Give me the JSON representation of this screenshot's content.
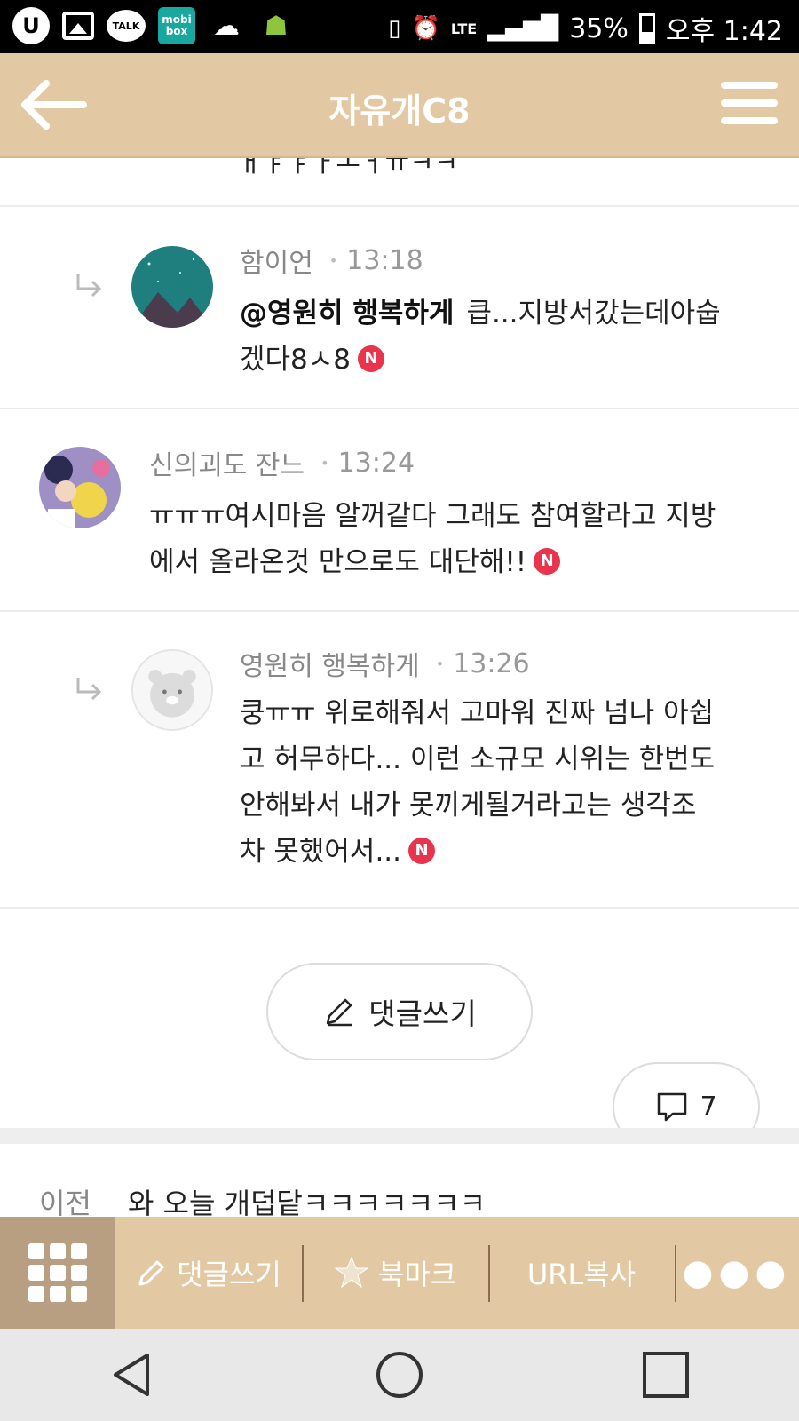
{
  "status_bar": {
    "left_icons": [
      "u-plus-icon",
      "gallery-icon",
      "kakaotalk-icon",
      "mobibox-icon",
      "bird-icon",
      "android-icon"
    ],
    "talk_label": "TALK",
    "mobi_label_top": "mobi",
    "mobi_label_bottom": "box",
    "network": "LTE",
    "battery": "35%",
    "time": "오후 1:42"
  },
  "header": {
    "title": "자유개C8"
  },
  "partial_comment": {
    "text": "ㅐㅑㅑㅏㅗㅓㅠㅋㅋ"
  },
  "comments": [
    {
      "reply": true,
      "author": "함이언",
      "time": "13:18",
      "mention": "@영원히 행복하게",
      "text_line1": "큽...지방서갔는데아숩",
      "text_line2": "겠다8ㅅ8",
      "badge": "N"
    },
    {
      "reply": false,
      "author": "신의괴도 잔느",
      "time": "13:24",
      "text_line1": "ㅠㅠㅠ여시마음 알꺼같다 그래도 참여할라고 지방",
      "text_line2": "에서 올라온것 만으로도 대단해!!",
      "badge": "N"
    },
    {
      "reply": true,
      "author": "영원히 행복하게",
      "time": "13:26",
      "text_line1": "쿵ㅠㅠ 위로해줘서 고마워 진짜 넘나 아쉽",
      "text_line2": "고 허무하다... 이런 소규모 시위는 한번도",
      "text_line3": "안해봐서 내가 못끼게될거라고는 생각조",
      "text_line4": "차 못했어서...",
      "badge": "N"
    }
  ],
  "write_button": {
    "label": "댓글쓰기"
  },
  "comment_count": {
    "value": "7"
  },
  "prev_post": {
    "label": "이전",
    "title": "와 오늘 개덥닽ㅋㅋㅋㅋㅋㅋㅋ"
  },
  "toolbar": {
    "write": "댓글쓰기",
    "bookmark": "북마크",
    "url_copy": "URL복사"
  },
  "colors": {
    "header_bg": "#e3c9a3",
    "toolbar_grid_bg": "#b99f81",
    "badge_red": "#e8344c"
  }
}
